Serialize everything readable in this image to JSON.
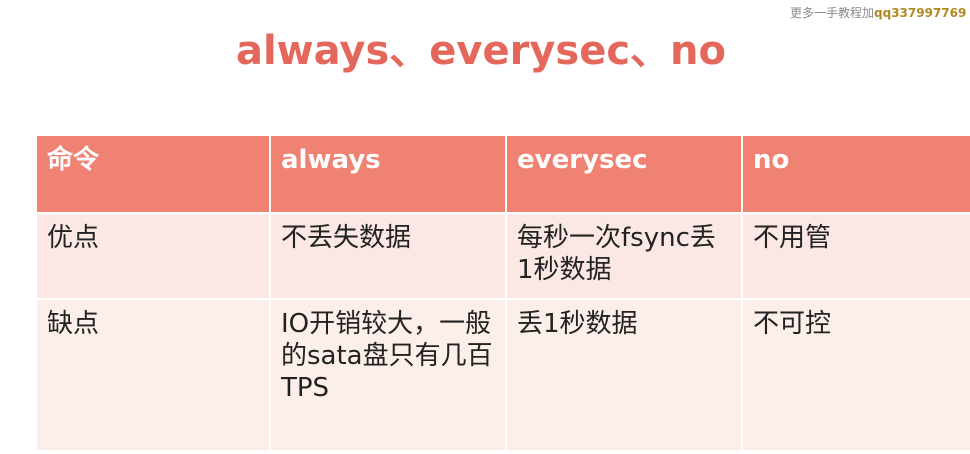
{
  "watermark": {
    "prefix": "更多一手教程加",
    "qq": "qq337997769"
  },
  "title": "always、everysec、no",
  "table": {
    "headers": [
      "命令",
      "always",
      "everysec",
      "no"
    ],
    "rows": [
      [
        "优点",
        "不丢失数据",
        "每秒一次fsync丢1秒数据",
        "不用管"
      ],
      [
        "缺点",
        "IO开销较大，一般的sata盘只有几百TPS",
        "丢1秒数据",
        "不可控"
      ]
    ]
  },
  "colors": {
    "title": "#e4675c",
    "header_bg": "#ef8272",
    "row_bg": "#fcefe9"
  }
}
